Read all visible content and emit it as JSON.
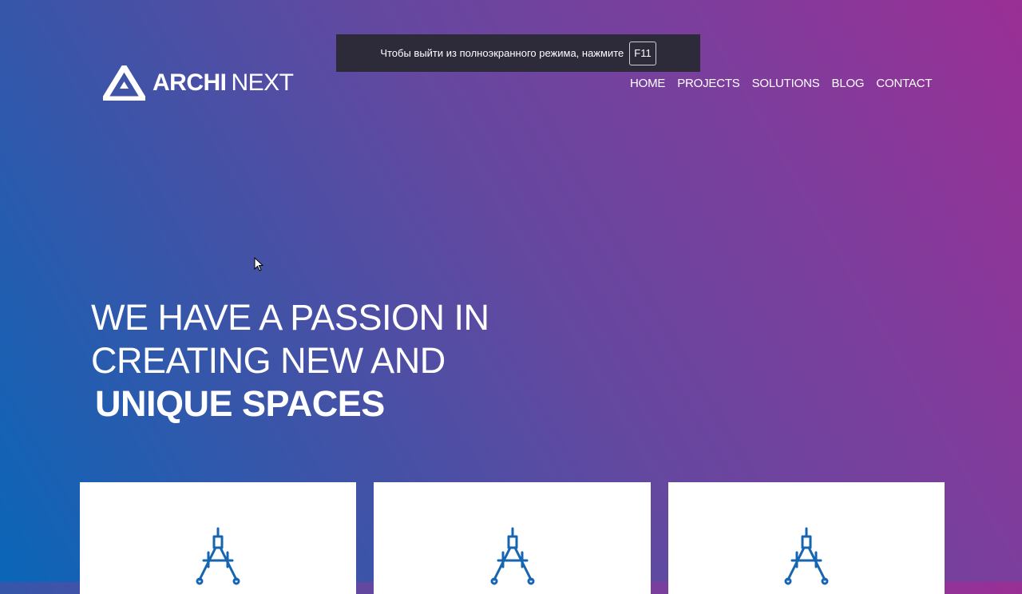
{
  "fullscreen_notice": {
    "text": "Чтобы выйти из полноэкранного режима, нажмите",
    "key": "F11"
  },
  "logo": {
    "icon": "triangle-logo-icon",
    "bold": "ARCHI",
    "light": "NEXT"
  },
  "nav": {
    "items": [
      {
        "label": "HOME"
      },
      {
        "label": "PROJECTS"
      },
      {
        "label": "SOLUTIONS"
      },
      {
        "label": "BLOG"
      },
      {
        "label": "CONTACT"
      }
    ]
  },
  "hero": {
    "line1": "WE HAVE A PASSION IN",
    "line2": "CREATING NEW AND",
    "line3": "UNIQUE SPACES"
  },
  "cards": [
    {
      "icon": "drafting-compass-icon"
    },
    {
      "icon": "drafting-compass-icon"
    },
    {
      "icon": "drafting-compass-icon"
    }
  ],
  "colors": {
    "gradient_start": "#0a66b8",
    "gradient_end": "#9a2f96",
    "icon_blue": "#1565b0",
    "notice_bg": "#2d2b3a"
  }
}
